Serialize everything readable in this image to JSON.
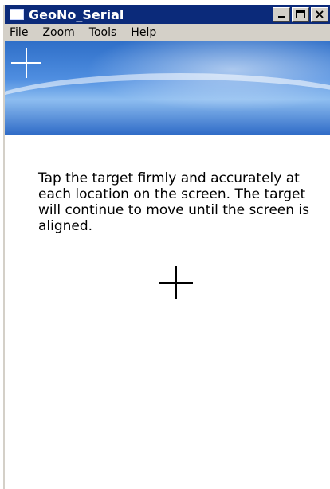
{
  "window": {
    "title": "GeoNo_Serial",
    "buttons": {
      "minimize": "_",
      "maximize": "□",
      "close": "×"
    }
  },
  "menu": [
    "File",
    "Zoom",
    "Tools",
    "Help"
  ],
  "content": {
    "instructions": "Tap the target firmly and accurately at each location on the screen. The target will continue to move until the screen is aligned."
  },
  "icons": {
    "app": "window-icon",
    "banner": "crosshair-icon",
    "target": "crosshair-target-icon"
  },
  "colors": {
    "titlebar": "#0b2a7a",
    "menubar": "#d4d0c8",
    "banner": "#4f8ee0"
  }
}
